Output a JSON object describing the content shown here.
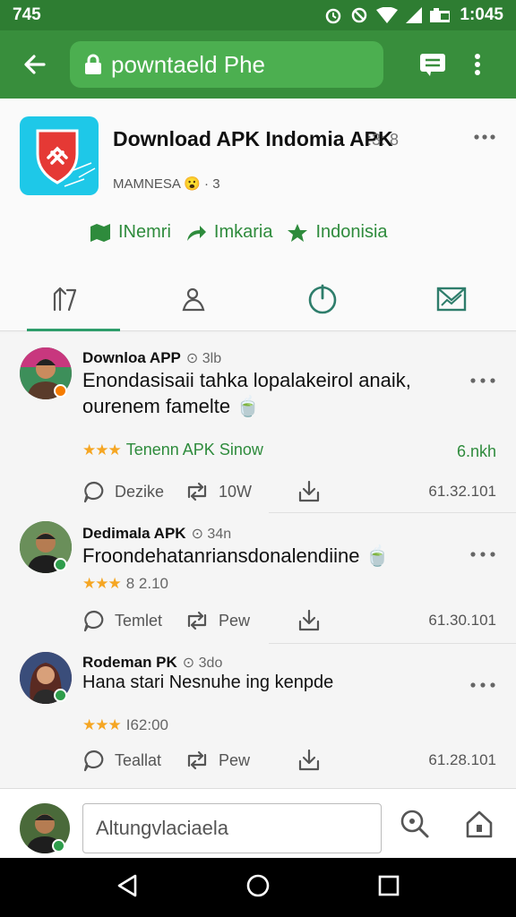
{
  "status_bar": {
    "left": "745",
    "time": "1:045"
  },
  "toolbar": {
    "url_text": "powntaeld Phe"
  },
  "app": {
    "title": "Download APK Indomia APK",
    "meta": "MAMNESA 😮 · 3",
    "meta_extra": ":3: 8",
    "chips": [
      "INemri",
      "Imkaria",
      "Indonisia"
    ]
  },
  "posts": [
    {
      "name": "Downloa APP",
      "sub": "⊙ 3lb",
      "text": "Enondasisaii tahka lopalakeirol anaik, ourenem famelte 🍵",
      "rating_label": "Tenenn APK Sinow",
      "rating_right": "6.nkh",
      "stars": "★★★",
      "actions": {
        "comment": "Dezike",
        "repost": "10W"
      },
      "time": "61.32.101"
    },
    {
      "name": "Dedimala APK",
      "sub": "⊙ 34n",
      "text": "Froondehatanriansdonalendiine 🍵",
      "stars": "★★★",
      "rating_value": "8 2.10",
      "actions": {
        "comment": "Temlet",
        "repost": "Pew"
      },
      "time": "61.30.101"
    },
    {
      "name": "Rodeman PK",
      "sub": "⊙ 3do",
      "text": "Hana stari Nesnuhe ing kenpde",
      "stars": "★★★",
      "rating_value": "I62:00",
      "actions": {
        "comment": "Teallat",
        "repost": "Pew"
      },
      "time": "61.28.101"
    }
  ],
  "composer": {
    "placeholder": "Altungvlaciaela"
  },
  "colors": {
    "status_bar": "#2e7d32",
    "toolbar": "#388e3c",
    "accent_green": "#2e8b3c",
    "star": "#f5a623",
    "tab_indicator": "#2e9d6b"
  }
}
